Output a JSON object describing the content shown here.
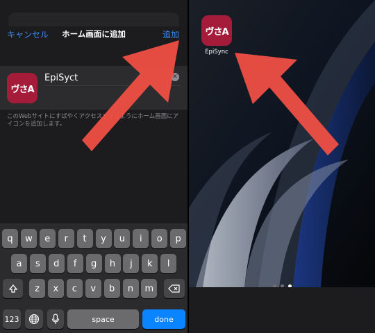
{
  "sheet": {
    "cancel_label": "キャンセル",
    "title": "ホーム画面に追加",
    "add_label": "追加",
    "app_name_value": "EpiSyct",
    "icon_text": "ヴさA",
    "description": "このWebサイトにすばやくアクセスできるようにホーム画面にアイコンを追加します。"
  },
  "keyboard": {
    "row1": [
      "q",
      "w",
      "e",
      "r",
      "t",
      "y",
      "u",
      "i",
      "o",
      "p"
    ],
    "row2": [
      "a",
      "s",
      "d",
      "f",
      "g",
      "h",
      "j",
      "k",
      "l"
    ],
    "row3": [
      "z",
      "x",
      "c",
      "v",
      "b",
      "n",
      "m"
    ],
    "numbers_label": "123",
    "space_label": "space",
    "done_label": "done"
  },
  "home": {
    "app_label": "EpiSync",
    "icon_text": "ヴさA"
  },
  "colors": {
    "accent": "#3a8cf5",
    "app_icon_bg": "#a51c3a",
    "arrow": "#ef4f45"
  }
}
